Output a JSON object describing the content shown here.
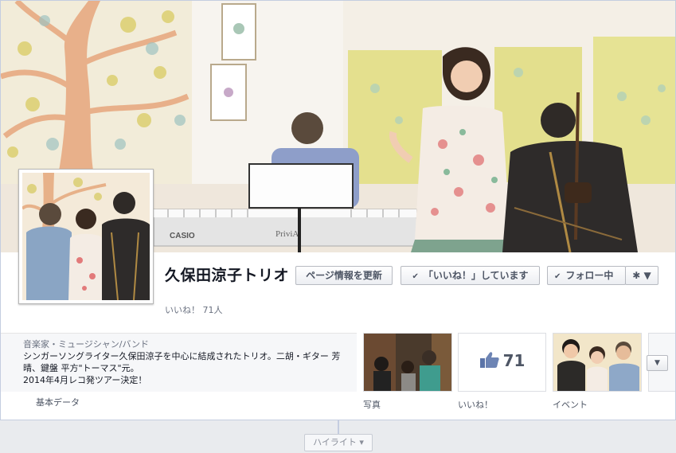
{
  "page": {
    "name": "久保田涼子トリオ",
    "likes_line": "いいね！ 71人"
  },
  "buttons": {
    "update_info": "ページ情報を更新",
    "liked": "「いいね！」しています",
    "following": "フォロー中",
    "gear_symbol": "✱ ▼"
  },
  "about": {
    "category": "音楽家・ミュージシャン/バンド",
    "description": "シンガーソングライター久保田涼子を中心に結成されたトリオ。二胡・ギター 芳晴、鍵盤 平方\"トーマス\"元。",
    "announcement": "2014年4月レコ発ツアー決定！",
    "basic_data_link": "基本データ"
  },
  "apps": {
    "photos_label": "写真",
    "likes_label": "いいね！",
    "likes_count": "71",
    "events_label": "イベント"
  },
  "cover_text": {
    "keyboard_brand": "CASIO",
    "keyboard_model": "PriviA"
  },
  "timeline": {
    "highlight_label": "ハイライト ▾"
  },
  "colors": {
    "link": "#4e5665",
    "border": "#c4cde0",
    "background": "#e9ebee"
  }
}
